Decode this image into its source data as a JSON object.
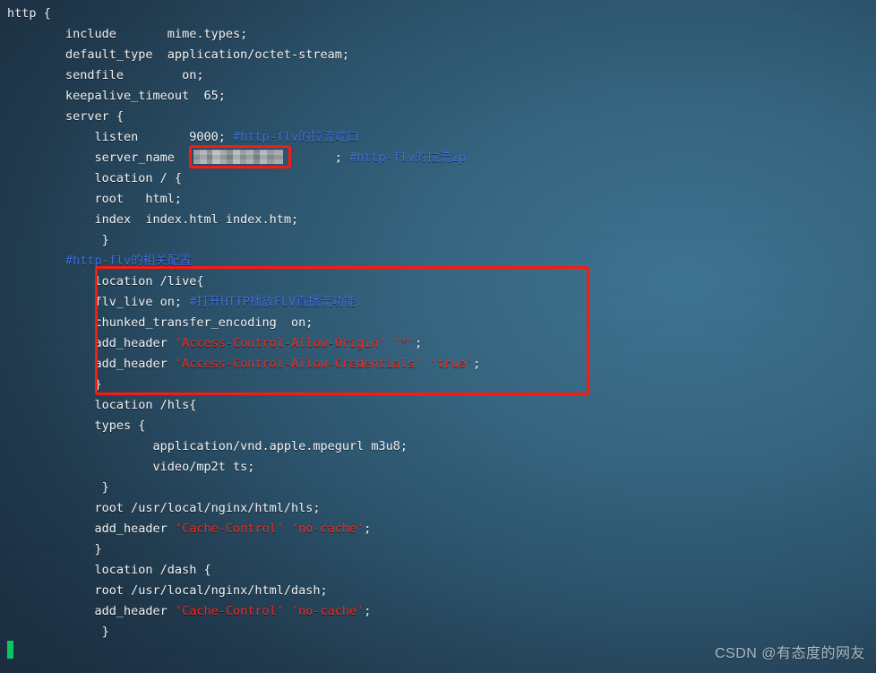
{
  "window": {
    "title": "nginx.conf",
    "background_top_left": "#25475e",
    "background_bright": "#3d7392",
    "background_bottom_left": "#1c3143",
    "text_color": "#f2f4f5",
    "comment_color": "#3f6ed8",
    "string_color": "#ee2b1e",
    "annotation_color": "#f81b10",
    "cursor_color": "#0bc963"
  },
  "editor": {
    "lines": [
      {
        "indent": 0,
        "text": "http {"
      },
      {
        "indent": 4,
        "text": "include       mime.types;"
      },
      {
        "indent": 4,
        "text": "default_type  application/octet-stream;"
      },
      {
        "indent": 4,
        "text": "sendfile        on;"
      },
      {
        "indent": 4,
        "text": "keepalive_timeout  65;"
      },
      {
        "indent": 4,
        "text": "server {"
      },
      {
        "indent": 8,
        "text": "listen       9000; ",
        "comment": "#http-flv的拉流端口"
      },
      {
        "indent": 8,
        "text": "server_name                     ; ",
        "comment": "#http-flv的拉流ip",
        "redacted": true
      },
      {
        "indent": 8,
        "text": "location / {"
      },
      {
        "indent": 8,
        "text": "root   html;"
      },
      {
        "indent": 8,
        "text": "index  index.html index.htm;"
      },
      {
        "indent": 9,
        "text": "}"
      },
      {
        "indent": 5,
        "text": "",
        "comment": "#http-flv的相关配置"
      },
      {
        "indent": 8,
        "text": "location /live{"
      },
      {
        "indent": 8,
        "text": "flv_live on; ",
        "comment": "#打开HTTP播放FLV直播流功能"
      },
      {
        "indent": 8,
        "text": "chunked_transfer_encoding  on;"
      },
      {
        "indent": 8,
        "text": "add_header ",
        "str1": "'Access-Control-Allow-Origin'",
        "mid": " ",
        "str2": "'*'",
        "tail": ";"
      },
      {
        "indent": 8,
        "text": "add_header ",
        "str1": "'Access-Control-Allow-Credentials'",
        "mid": " ",
        "str2": "'true'",
        "tail": ";"
      },
      {
        "indent": 8,
        "text": "}"
      },
      {
        "indent": 8,
        "text": "location /hls{"
      },
      {
        "indent": 8,
        "text": "types {"
      },
      {
        "indent": 12,
        "text": "application/vnd.apple.mpegurl m3u8;"
      },
      {
        "indent": 12,
        "text": "video/mp2t ts;"
      },
      {
        "indent": 9,
        "text": "}"
      },
      {
        "indent": 8,
        "text": "root /usr/local/nginx/html/hls;"
      },
      {
        "indent": 8,
        "text": "add_header ",
        "str1": "'Cache-Control'",
        "mid": " ",
        "str2": "'no-cache'",
        "tail": ";"
      },
      {
        "indent": 8,
        "text": "}"
      },
      {
        "indent": 8,
        "text": "location /dash {"
      },
      {
        "indent": 8,
        "text": "root /usr/local/nginx/html/dash;"
      },
      {
        "indent": 8,
        "text": "add_header ",
        "str1": "'Cache-Control'",
        "mid": " ",
        "str2": "'no-cache'",
        "tail": ";"
      },
      {
        "indent": 8,
        "text": "}"
      }
    ],
    "rendered": "http {\n        include       mime.types;\n        default_type  application/octet-stream;\n        sendfile        on;\n        keepalive_timeout  65;\n        server {\n            listen       9000;\n            server_name                     ;\n            location / {\n            root   html;\n            index  index.html index.htm;\n             }\n\n            location /live{\n            flv_live on;\n            chunked_transfer_encoding  on;\n            add_header 'Access-Control-Allow-Origin' '*';\n            add_header 'Access-Control-Allow-Credentials' 'true';\n            }\n            location /hls{\n            types {\n                    application/vnd.apple.mpegurl m3u8;\n                    video/mp2t ts;\n             }\n            root /usr/local/nginx/html/hls;\n            add_header 'Cache-Control' 'no-cache';\n            }\n            location /dash {\n            root /usr/local/nginx/html/dash;\n            add_header 'Cache-Control' 'no-cache';\n            }"
  },
  "code_text": {
    "l01": "http {",
    "l02": "        include       mime.types;",
    "l03": "        default_type  application/octet-stream;",
    "l04": "        sendfile        on;",
    "l05": "        keepalive_timeout  65;",
    "l06": "        server {",
    "l07a": "            listen       9000; ",
    "l07b": "#http-flv的拉流端口",
    "l08a": "            server_name  ",
    "l08b": "                    ",
    "l08c": "; ",
    "l08d": "#http-flv的拉流ip",
    "l09": "            location / {",
    "l10": "            root   html;",
    "l11": "            index  index.html index.htm;",
    "l12": "             }",
    "l13": "        #http-flv的相关配置",
    "l14": "            location /live{",
    "l15a": "            flv_live on; ",
    "l15b": "#打开HTTP播放FLV直播流功能",
    "l16": "            chunked_transfer_encoding  on;",
    "l17a": "            add_header ",
    "l17b": "'Access-Control-Allow-Origin'",
    "l17c": " ",
    "l17d": "'*'",
    "l17e": ";",
    "l18a": "            add_header ",
    "l18b": "'Access-Control-Allow-Credentials'",
    "l18c": " ",
    "l18d": "'true'",
    "l18e": ";",
    "l19": "            }",
    "l20": "            location /hls{",
    "l21": "            types {",
    "l22": "                    application/vnd.apple.mpegurl m3u8;",
    "l23": "                    video/mp2t ts;",
    "l24": "             }",
    "l25": "            root /usr/local/nginx/html/hls;",
    "l26a": "            add_header ",
    "l26b": "'Cache-Control'",
    "l26c": " ",
    "l26d": "'no-cache'",
    "l26e": ";",
    "l27": "            }",
    "l28": "            location /dash {",
    "l29": "            root /usr/local/nginx/html/dash;",
    "l30a": "            add_header ",
    "l30b": "'Cache-Control'",
    "l30c": " ",
    "l30d": "'no-cache'",
    "l30e": ";",
    "l31": "             }"
  },
  "annotations": {
    "server_name_box_label": "server_name value highlight",
    "flv_block_box_label": "http-flv location block highlight",
    "redaction_label": "redacted server_name value"
  },
  "watermark": {
    "text": "CSDN @有态度的网友"
  }
}
